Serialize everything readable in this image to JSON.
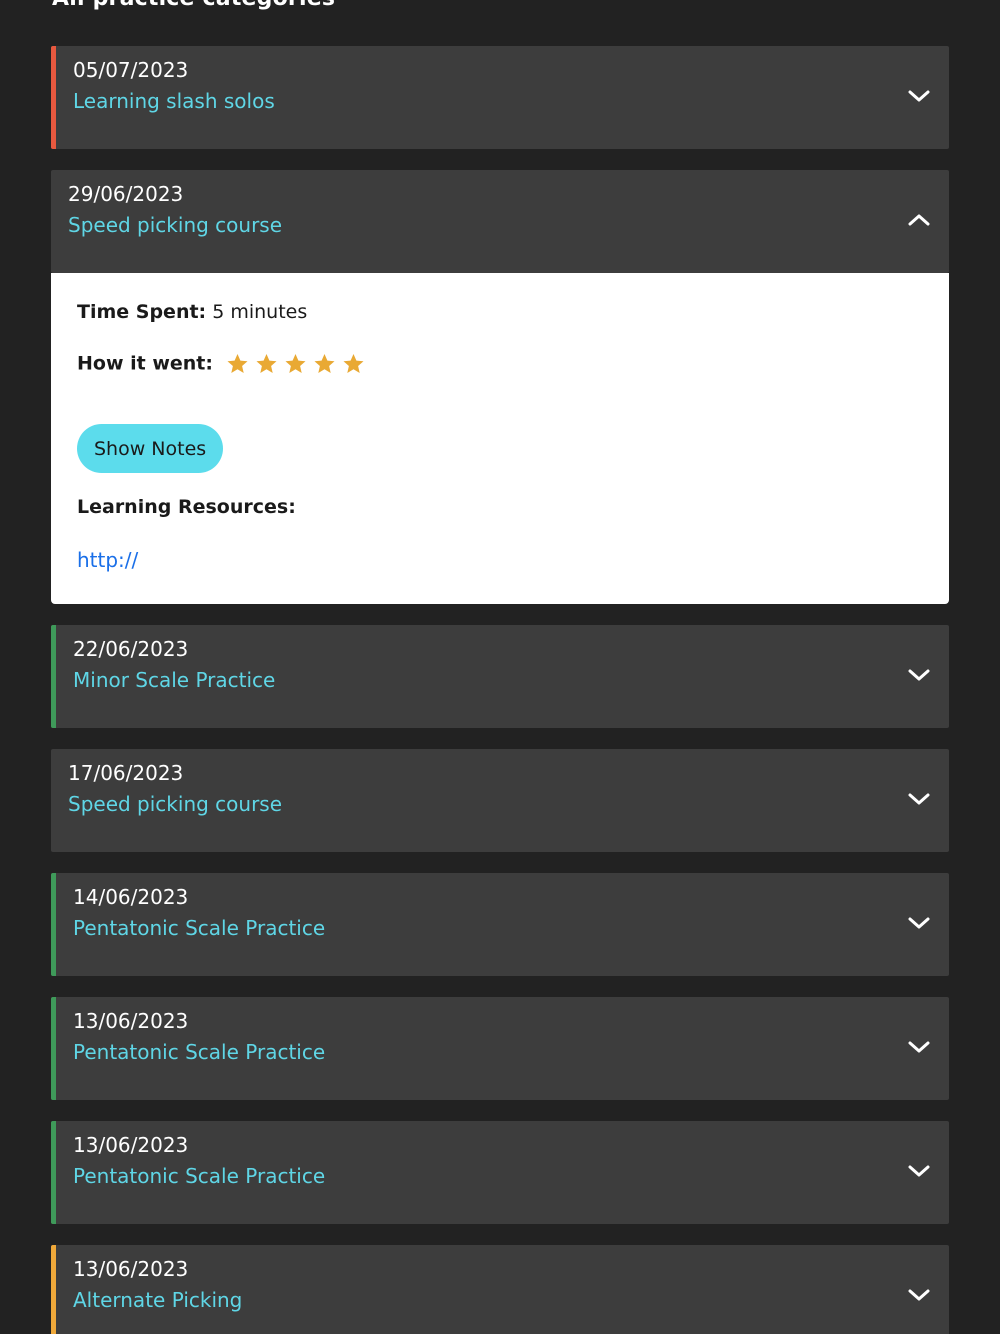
{
  "section": {
    "title": "All practice categories"
  },
  "colors": {
    "accent_text": "#5fd6e6",
    "card_bg": "#3d3d3d",
    "page_bg": "#222222",
    "star": "#e9a934",
    "button_bg": "#5cdcec",
    "link": "#1a6fe8"
  },
  "entries": [
    {
      "date": "05/07/2023",
      "name": "Learning slash solos",
      "bar_color": "#e8593f",
      "expanded": false,
      "chevron_icon": "chevron-down-icon"
    },
    {
      "date": "29/06/2023",
      "name": "Speed picking course",
      "bar_color": "",
      "expanded": true,
      "chevron_icon": "chevron-up-icon"
    },
    {
      "date": "22/06/2023",
      "name": "Minor Scale Practice",
      "bar_color": "#3f9a5a",
      "expanded": false,
      "chevron_icon": "chevron-down-icon"
    },
    {
      "date": "17/06/2023",
      "name": "Speed picking course",
      "bar_color": "",
      "expanded": false,
      "chevron_icon": "chevron-down-icon"
    },
    {
      "date": "14/06/2023",
      "name": "Pentatonic Scale Practice",
      "bar_color": "#3f9a5a",
      "expanded": false,
      "chevron_icon": "chevron-down-icon"
    },
    {
      "date": "13/06/2023",
      "name": "Pentatonic Scale Practice",
      "bar_color": "#3f9a5a",
      "expanded": false,
      "chevron_icon": "chevron-down-icon"
    },
    {
      "date": "13/06/2023",
      "name": "Pentatonic Scale Practice",
      "bar_color": "#3f9a5a",
      "expanded": false,
      "chevron_icon": "chevron-down-icon"
    },
    {
      "date": "13/06/2023",
      "name": "Alternate Picking",
      "bar_color": "#f0a93a",
      "expanded": false,
      "chevron_icon": "chevron-down-icon"
    }
  ],
  "details": {
    "time_spent_label": "Time Spent:",
    "time_spent_value": "5 minutes",
    "how_it_went_label": "How it went:",
    "rating": 5,
    "rating_max": 5,
    "star_icon": "star-icon",
    "notes_button": "Show Notes",
    "resources_label": "Learning Resources:",
    "resource_link": "http://"
  }
}
